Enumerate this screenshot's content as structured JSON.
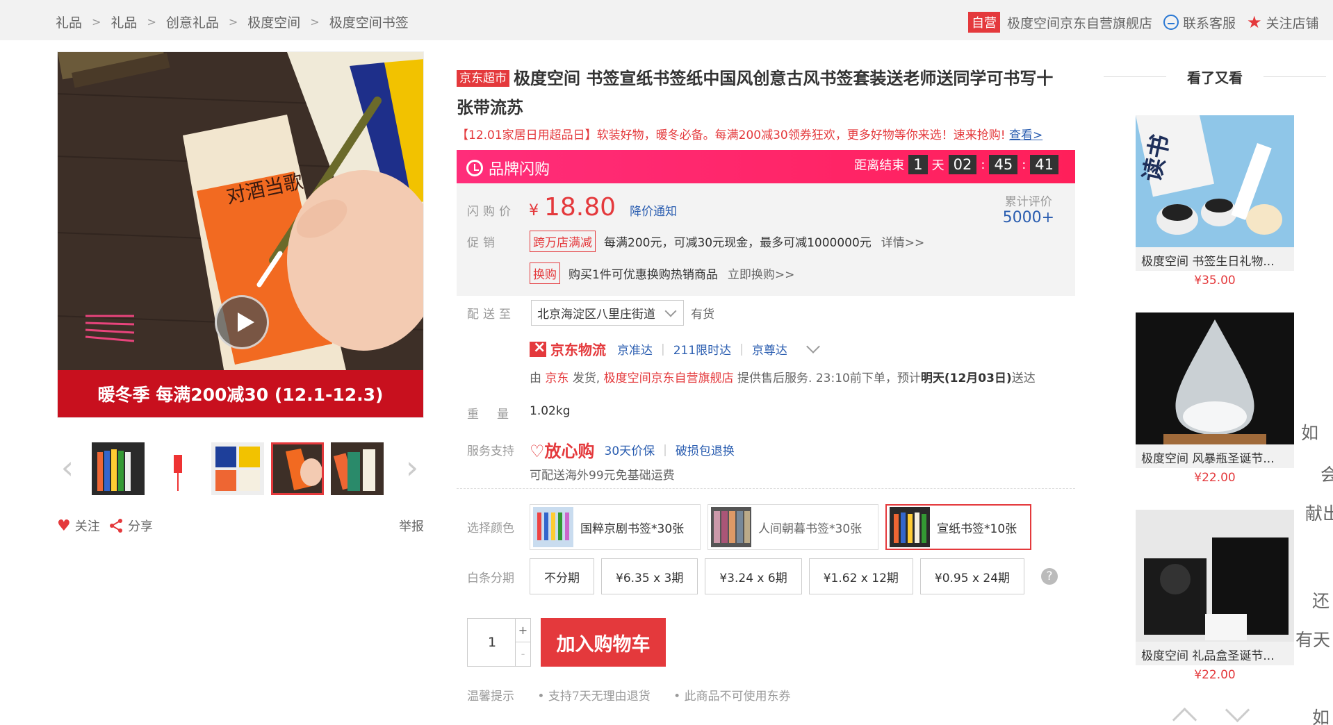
{
  "breadcrumb": [
    "礼品",
    "礼品",
    "创意礼品",
    "极度空间",
    "极度空间书签"
  ],
  "shop": {
    "badge": "自营",
    "name": "极度空间京东自营旗舰店",
    "contact": "联系客服",
    "follow": "关注店铺"
  },
  "gallery": {
    "banner": "暖冬季 每满200减30 (12.1-12.3)",
    "image_text": "对酒当歌",
    "follow": "关注",
    "share": "分享",
    "report": "举报"
  },
  "product": {
    "badge": "京东超市",
    "title": "极度空间 书签宣纸书签纸中国风创意古风书签套装送老师送同学可书写十张带流苏",
    "promo": "【12.01家居日用超品日】软装好物，暖冬必备。每满200减30领券狂欢，更多好物等你来选！速来抢购!",
    "promo_link": "查看>"
  },
  "flash": {
    "label": "品牌闪购",
    "ends_label": "距离结束",
    "days": "1",
    "day_unit": "天",
    "hours": "02",
    "minutes": "45",
    "seconds": "41",
    "colon": ":"
  },
  "price": {
    "label": "闪购价",
    "currency": "¥",
    "value": "18.80",
    "notify": "降价通知",
    "review_label": "累计评价",
    "review_count": "5000+"
  },
  "promotion": {
    "label": "促销",
    "tag1": "跨万店满减",
    "text1": "每满200元，可减30元现金，最多可减1000000元",
    "more1": "详情>>",
    "tag2": "换购",
    "text2": "购买1件可优惠换购热销商品",
    "more2": "立即换购>>"
  },
  "delivery": {
    "label": "配送至",
    "address": "北京海淀区八里庄街道",
    "stock": "有货",
    "logistics": "京东物流",
    "services": [
      "京准达",
      "211限时达",
      "京尊达"
    ],
    "ship_from_prefix": "由",
    "ship_from": "京东",
    "ship_mid": "发货,",
    "seller": "极度空间京东自营旗舰店",
    "ship_suffix": "提供售后服务. 23:10前下单，预计",
    "eta": "明天(12月03日)",
    "eta_suffix": "送达"
  },
  "weight": {
    "label": "重量",
    "value": "1.02kg"
  },
  "service": {
    "label": "服务支持",
    "brand": "放心购",
    "items": [
      "30天价保",
      "破损包退换"
    ],
    "overseas": "可配送海外99元免基础运费"
  },
  "color": {
    "label": "选择颜色",
    "options": [
      "国粹京剧书签*30张",
      "人间朝暮书签*30张",
      "宣纸书签*10张"
    ]
  },
  "installment": {
    "label": "白条分期",
    "options": [
      "不分期",
      "¥6.35 x 3期",
      "¥3.24 x 6期",
      "¥1.62 x 12期",
      "¥0.95 x 24期"
    ],
    "help": "?"
  },
  "cart": {
    "qty": "1",
    "plus": "+",
    "minus": "-",
    "add_label": "加入购物车"
  },
  "tips": {
    "label": "温馨提示",
    "items": [
      "• 支持7天无理由退货",
      "• 此商品不可使用东券"
    ]
  },
  "side": {
    "title": "看了又看",
    "items": [
      {
        "name": "极度空间 书签生日礼物...",
        "price": "¥35.00"
      },
      {
        "name": "极度空间 风暴瓶圣诞节...",
        "price": "¥22.00"
      },
      {
        "name": "极度空间 礼品盒圣诞节...",
        "price": "¥22.00"
      }
    ]
  },
  "edge_text": [
    "如",
    "会",
    "献出",
    "还",
    "有天",
    "如"
  ],
  "colors": {
    "accent": "#e4393c",
    "link": "#2a5db0",
    "flash": "#ff2d7a"
  }
}
